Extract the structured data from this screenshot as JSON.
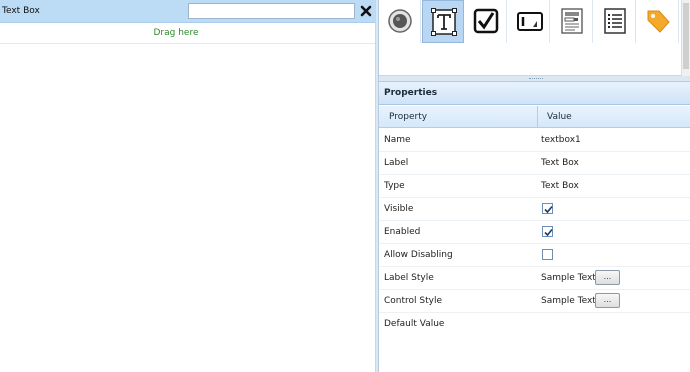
{
  "canvas": {
    "control_label": "Text Box",
    "input_value": "",
    "drag_hint": "Drag here"
  },
  "toolbox": {
    "tools": [
      {
        "name": "radio-button-tool",
        "icon": "radio-icon"
      },
      {
        "name": "text-box-tool",
        "icon": "text-box-icon",
        "selected": true
      },
      {
        "name": "checkbox-tool",
        "icon": "checkbox-icon"
      },
      {
        "name": "label-tool",
        "icon": "label-icon"
      },
      {
        "name": "dropdown-tool",
        "icon": "dropdown-form-icon"
      },
      {
        "name": "list-tool",
        "icon": "list-icon"
      },
      {
        "name": "tag-tool",
        "icon": "tag-icon"
      }
    ]
  },
  "properties": {
    "title": "Properties",
    "col_property": "Property",
    "col_value": "Value",
    "rows": [
      {
        "name": "Name",
        "value": "textbox1"
      },
      {
        "name": "Label",
        "value": "Text Box"
      },
      {
        "name": "Type",
        "value": "Text Box"
      },
      {
        "name": "Visible",
        "checked": true
      },
      {
        "name": "Enabled",
        "checked": true
      },
      {
        "name": "Allow Disabling",
        "checked": false
      },
      {
        "name": "Label Style",
        "value": "Sample Text",
        "button": "..."
      },
      {
        "name": "Control Style",
        "value": "Sample Text",
        "button": "..."
      },
      {
        "name": "Default Value",
        "value": ""
      }
    ]
  },
  "colors": {
    "selected_row": "#bcdcf6",
    "drag_hint": "#2e8a2e",
    "tag_orange": "#f4a92c"
  }
}
